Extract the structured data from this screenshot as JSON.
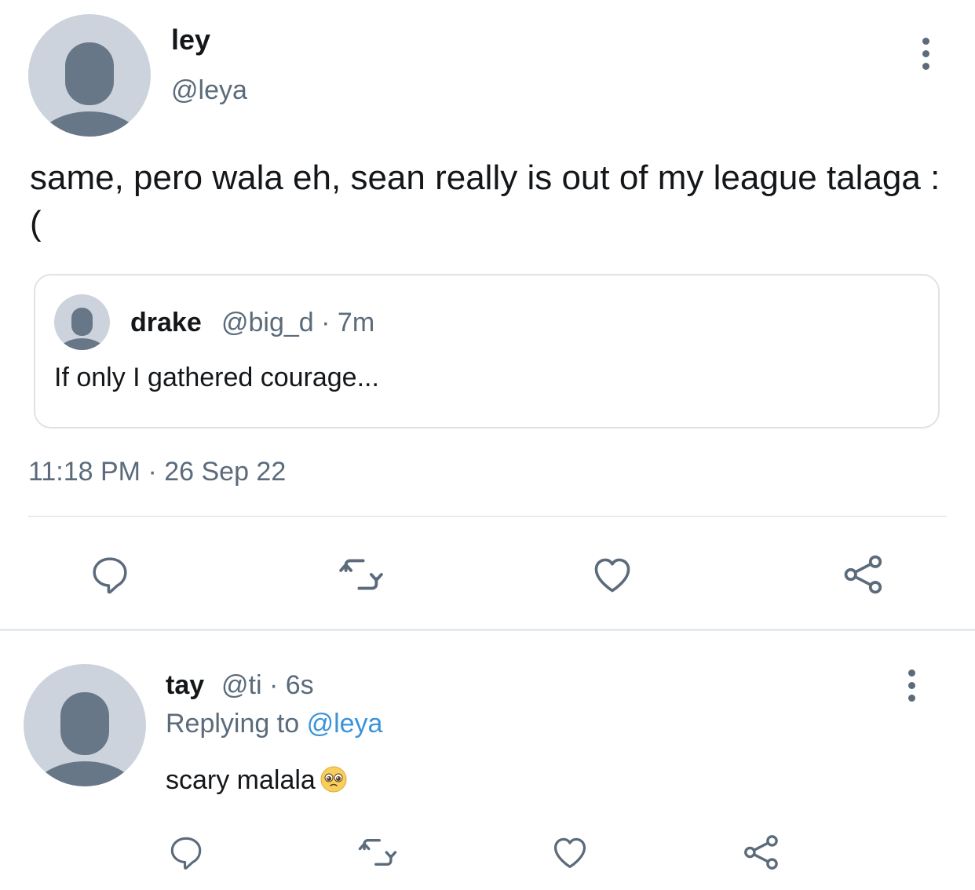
{
  "main_tweet": {
    "display_name": "ley",
    "handle": "@leya",
    "text": "same, pero wala eh, sean really is out of my league talaga :(",
    "timestamp": "11:18 PM · 26 Sep 22",
    "avatar_icon": "default-avatar-icon",
    "more_icon": "more-vertical-icon"
  },
  "quoted_tweet": {
    "display_name": "drake",
    "meta": "@big_d · 7m",
    "text": "If only I gathered courage..."
  },
  "actions": {
    "icons": [
      "reply-icon",
      "retweet-icon",
      "like-icon",
      "share-icon"
    ]
  },
  "reply_tweet": {
    "display_name": "tay",
    "meta": "@ti · 6s",
    "replying_prefix": "Replying to",
    "replying_to": "@leya",
    "text": "scary malala",
    "emoji": "pleading-face-emoji"
  },
  "colors": {
    "text_primary": "#14171a",
    "text_secondary": "#5b6b7b",
    "link": "#3b94d9",
    "avatar_bg": "#ccd3dc",
    "avatar_fg": "#687787",
    "divider": "#e6ebef",
    "icon": "#5b6b7b"
  }
}
